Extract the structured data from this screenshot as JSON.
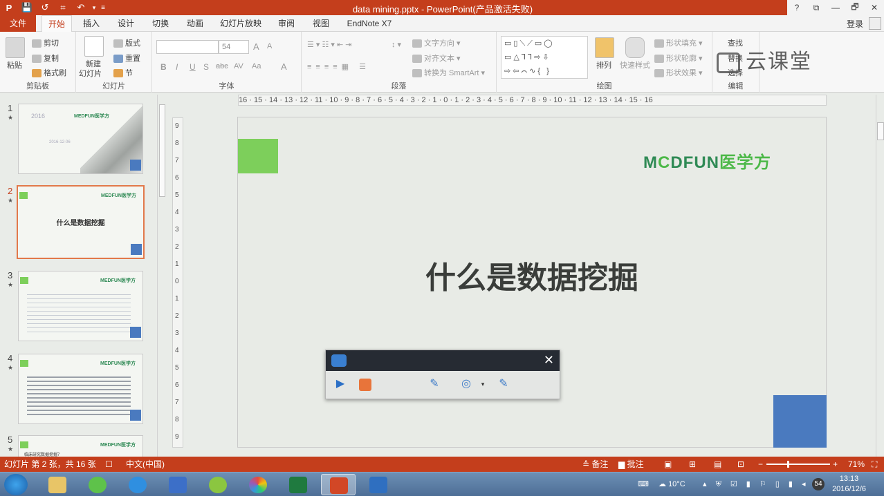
{
  "window": {
    "title": "data mining.pptx - PowerPoint(产品激活失败)"
  },
  "qat": {
    "items": [
      "P",
      "💾",
      "↺",
      "⌗",
      "↶",
      "▾",
      "≡"
    ]
  },
  "winbtns": [
    "?",
    "⧉",
    "—",
    "🗗",
    "✕"
  ],
  "tabs": [
    {
      "label": "文件"
    },
    {
      "label": "开始"
    },
    {
      "label": "插入"
    },
    {
      "label": "设计"
    },
    {
      "label": "切换"
    },
    {
      "label": "动画"
    },
    {
      "label": "幻灯片放映"
    },
    {
      "label": "审阅"
    },
    {
      "label": "视图"
    },
    {
      "label": "EndNote X7"
    }
  ],
  "account": {
    "login": "登录"
  },
  "ribbon": {
    "clipboard": {
      "paste": "粘贴",
      "cut": "剪切",
      "copy": "复制",
      "painter": "格式刷",
      "label": "剪贴板"
    },
    "slides": {
      "new_slide": "新建",
      "new_slide2": "幻灯片",
      "layout": "版式",
      "reset": "重置",
      "section": "节",
      "label": "幻灯片"
    },
    "font": {
      "size": "54",
      "bold": "B",
      "italic": "I",
      "underline": "U",
      "shadow": "S",
      "strike": "abc",
      "spacing": "AV",
      "case": "Aa",
      "color": "A",
      "grow": "A",
      "shrink": "A",
      "label": "字体"
    },
    "paragraph": {
      "text_dir": "文字方向",
      "align_text": "对齐文本",
      "smartart": "转换为 SmartArt",
      "label": "段落"
    },
    "drawing": {
      "shapes": "▭▯⟍⟋▭◯ ▭△⅂⅂⇨⇩ ⇨⇦⌒∿{ }",
      "arrange": "排列",
      "quick": "快速样式",
      "fill": "形状填充",
      "outline": "形状轮廓",
      "effect": "形状效果",
      "label": "绘图"
    },
    "editing": {
      "find": "查找",
      "replace": "替换",
      "select": "选择",
      "label": "编辑"
    }
  },
  "watermark": {
    "text": "云课堂"
  },
  "thumbnails": [
    {
      "num": "1",
      "star": "★",
      "text": "2016",
      "sub": "2016-12-06"
    },
    {
      "num": "2",
      "star": "★",
      "title": "什么是数据挖掘"
    },
    {
      "num": "3",
      "star": "★"
    },
    {
      "num": "4",
      "star": "★"
    },
    {
      "num": "5",
      "star": "★",
      "sub": "临床研究数据挖掘？"
    }
  ],
  "thumb_logo": "MEDFUN医学方",
  "hruler": "16 · 15 · 14 · 13 · 12 · 11 · 10 · 9 · 8 · 7 · 6 · 5 · 4 · 3 · 2 · 1 · 0 · 1 · 2 · 3 · 4 · 5 · 6 · 7 · 8 · 9 · 10 · 11 · 12 · 13 · 14 · 15 · 16",
  "vruler": [
    "9",
    "8",
    "7",
    "6",
    "5",
    "4",
    "3",
    "2",
    "1",
    "0",
    "1",
    "2",
    "3",
    "4",
    "5",
    "6",
    "7",
    "8",
    "9"
  ],
  "slide": {
    "logo_a": "M",
    "logo_b": "C",
    "logo_c": "DFUN",
    "logo_d": "医学方",
    "title": "什么是数据挖掘"
  },
  "recorder": {
    "close": "✕",
    "play": "▶",
    "pen": "✎",
    "cam": "◎",
    "caret": "▾"
  },
  "status": {
    "slide_info": "幻灯片 第 2 张，共 16 张",
    "lang": "中文(中国)",
    "notes": "备注",
    "comments": "批注",
    "zoom": "71%",
    "minus": "−",
    "plus": "+"
  },
  "tray": {
    "temp": "10°C",
    "network": "54",
    "time": "13:13",
    "date": "2016/12/6"
  },
  "colors": {
    "accent": "#c43e1c",
    "slide_green": "#7dcf5b",
    "slide_blue": "#4a7abf",
    "logo": "#2f8a55"
  }
}
